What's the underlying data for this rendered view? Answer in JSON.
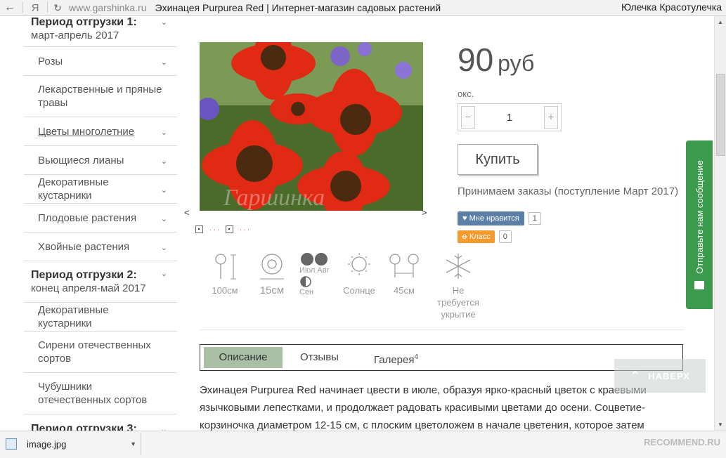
{
  "browser": {
    "back_icon": "←",
    "ya_icon": "Я",
    "url": "www.garshinka.ru",
    "separator": "▸",
    "page_title": "Эхинацея Purpurea Red | Интернет-магазин садовых растений",
    "user": "Юлечка Красотулечка"
  },
  "sidebar": {
    "group1_title": "Период отгрузки 1:",
    "group1_sub": "март-апрель 2017",
    "items1": [
      "Розы",
      "Лекарственные и пряные травы",
      "Цветы многолетние",
      "Вьющиеся лианы",
      "Декоративные кустарники",
      "Плодовые растения",
      "Хвойные растения"
    ],
    "group2_title": "Период отгрузки 2:",
    "group2_sub": "конец апреля-май 2017",
    "items2": [
      "Декоративные кустарники",
      "Сирени отечественных сортов",
      "Чубушники отечественных сортов"
    ],
    "group3_title": "Период отгрузки 3:"
  },
  "product": {
    "price": "90",
    "currency": "руб",
    "unit": "окс.",
    "qty": "1",
    "minus": "−",
    "plus": "+",
    "buy_label": "Купить",
    "orders_note": "Принимаем заказы (поступление Март 2017)",
    "watermark": "Гаршинка",
    "prev": "<",
    "next": ">",
    "dots": "· · ·"
  },
  "social": {
    "vk_label": "Мне нравится",
    "vk_count": "1",
    "ok_label": "Класс",
    "ok_count": "0"
  },
  "specs": {
    "height": "100см",
    "size": "15см",
    "bloom_months": "Июл Авг",
    "bloom_month2": "Сен",
    "light": "Солнце",
    "spacing": "45см",
    "cover_line1": "Не требуется",
    "cover_line2": "укрытие"
  },
  "tabs": {
    "description": "Описание",
    "reviews": "Отзывы",
    "gallery": "Галерея",
    "gallery_count": "4"
  },
  "description": {
    "line1": "Эхинацея Purpurea Red начинает цвести в июле, образуя ярко-красный цветок с краевыми",
    "line2": "язычковыми лепестками, и продолжает радовать красивыми цветами до осени. Соцветие-",
    "line3": "корзиночка диаметром 12-15 см, с плоским цветоложем в начале цветения, которое затем"
  },
  "to_top": {
    "label": "НАВЕРХ"
  },
  "feedback": {
    "label": "Отправьте нам сообщение"
  },
  "download": {
    "file": "image.jpg",
    "watermark": "RECOMMEND.RU"
  },
  "colors": {
    "accent_green": "#3b9a4b",
    "tab_active": "#a9c0a4",
    "vk": "#5b7fa6",
    "ok": "#f29a2e"
  }
}
